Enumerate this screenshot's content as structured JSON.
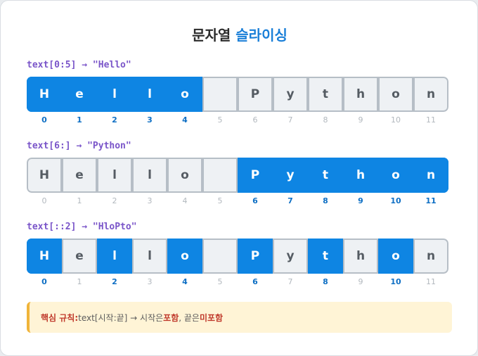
{
  "title": {
    "prefix": "문자열 ",
    "accent": "슬라이싱"
  },
  "chars": [
    "H",
    "e",
    "l",
    "l",
    "o",
    "",
    "P",
    "y",
    "t",
    "h",
    "o",
    "n"
  ],
  "indices": [
    "0",
    "1",
    "2",
    "3",
    "4",
    "5",
    "6",
    "7",
    "8",
    "9",
    "10",
    "11"
  ],
  "rows": [
    {
      "label": "text[0:5] → \"Hello\"",
      "highlight": [
        0,
        1,
        2,
        3,
        4
      ]
    },
    {
      "label": "text[6:] → \"Python\"",
      "highlight": [
        6,
        7,
        8,
        9,
        10,
        11
      ]
    },
    {
      "label": "text[::2] → \"HloPto\"",
      "highlight": [
        0,
        2,
        4,
        6,
        8,
        10
      ]
    }
  ],
  "note": {
    "label": "핵심 규칙:",
    "syntax": " text[시작:끝] → 시작은 ",
    "include": "포함",
    "mid": ", 끝은 ",
    "exclude": "미포함"
  },
  "colors": {
    "highlight": "#0e85e3",
    "accent": "#1a7fd8",
    "label": "#7a55c9",
    "warn": "#c0392b"
  }
}
